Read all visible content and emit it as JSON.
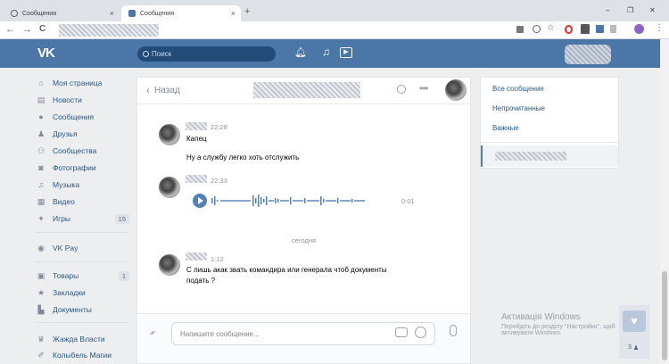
{
  "browser": {
    "tabs": [
      {
        "label": "Сообщения",
        "close": "×"
      },
      {
        "label": "Сообщения",
        "close": "×"
      }
    ],
    "new_tab": "+",
    "window_controls": [
      "–",
      "❐",
      "✕"
    ],
    "nav": {
      "back": "←",
      "forward": "→",
      "reload": "C"
    }
  },
  "vk": {
    "logo": "VK",
    "search_placeholder": "Поиск",
    "brand_color": "#4a76a8"
  },
  "sidebar": {
    "items": [
      {
        "label": "Моя страница",
        "icon": "home-icon",
        "glyph": "⌂"
      },
      {
        "label": "Новости",
        "icon": "news-icon",
        "glyph": "▤"
      },
      {
        "label": "Сообщения",
        "icon": "messages-icon",
        "glyph": "●"
      },
      {
        "label": "Друзья",
        "icon": "friends-icon",
        "glyph": "♟"
      },
      {
        "label": "Сообщества",
        "icon": "communities-icon",
        "glyph": "⚇"
      },
      {
        "label": "Фотографии",
        "icon": "photos-icon",
        "glyph": "◙"
      },
      {
        "label": "Музыка",
        "icon": "music-icon",
        "glyph": "♫"
      },
      {
        "label": "Видео",
        "icon": "video-icon",
        "glyph": "▦"
      },
      {
        "label": "Игры",
        "icon": "games-icon",
        "glyph": "✦",
        "count": "15"
      }
    ],
    "pay": {
      "label": "VK Pay",
      "icon": "vkpay-icon",
      "glyph": "◉"
    },
    "extra": [
      {
        "label": "Товары",
        "icon": "goods-icon",
        "glyph": "▣",
        "count": "1"
      },
      {
        "label": "Закладки",
        "icon": "bookmarks-icon",
        "glyph": "★"
      },
      {
        "label": "Документы",
        "icon": "documents-icon",
        "glyph": "▙"
      }
    ],
    "groups": [
      {
        "label": "Жажда Власти",
        "icon": "group-icon",
        "glyph": "♛"
      },
      {
        "label": "Колыбель Магии",
        "icon": "group-icon",
        "glyph": "✐"
      }
    ]
  },
  "chat": {
    "back_label": "Назад",
    "messages": [
      {
        "time": "22:28",
        "lines": [
          "Капец",
          "Ну а службу легко хоть отслужить"
        ]
      },
      {
        "time": "22:33",
        "voice_duration": "0:01"
      },
      {
        "divider": "сегодня"
      },
      {
        "time": "1:12",
        "lines": [
          "С лишь акак звать командира или генерала чтоб документы",
          "подать ?"
        ]
      }
    ],
    "input_placeholder": "Напишите сообщение..."
  },
  "right_panel": {
    "items": [
      "Все сообщения",
      "Непрочитанные",
      "Важные"
    ]
  },
  "watermark": {
    "title": "Активація Windows",
    "line1": "Перейдіть до розділу \"Настройки\", щоб",
    "line2": "активувати Windows."
  },
  "bottom_counter": "3"
}
